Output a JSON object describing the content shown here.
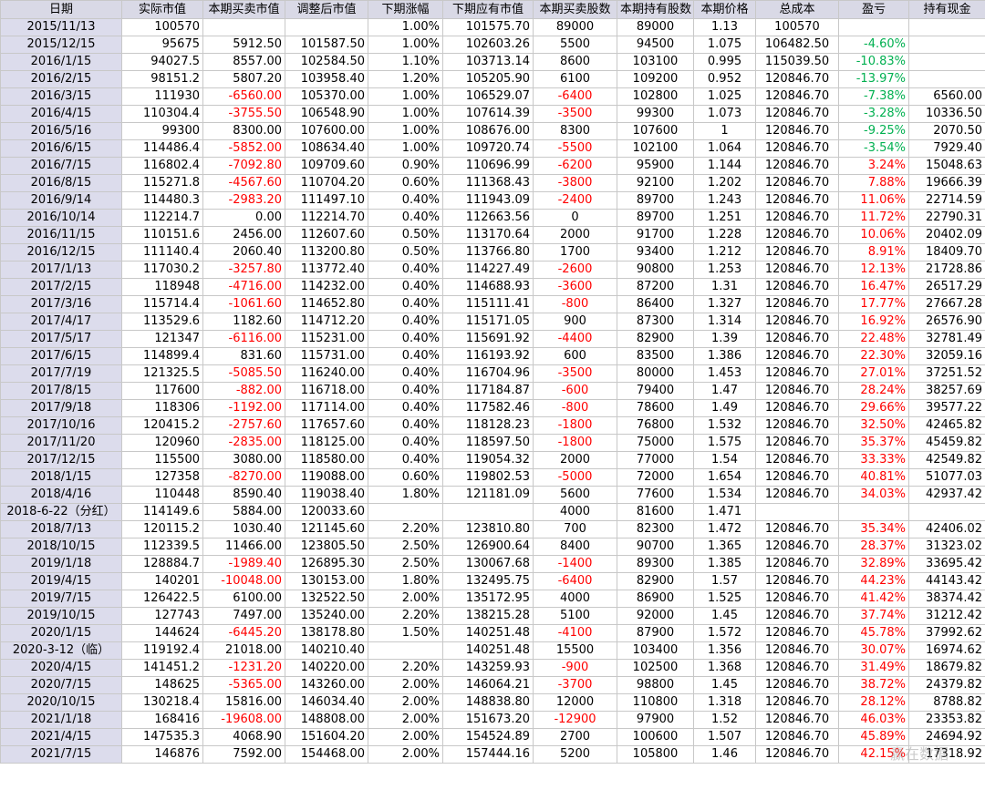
{
  "headers": [
    "日期",
    "实际市值",
    "本期买卖市值",
    "调整后市值",
    "下期涨幅",
    "下期应有市值",
    "本期买卖股数",
    "本期持有股数",
    "本期价格",
    "总成本",
    "盈亏",
    "持有现金"
  ],
  "rows": [
    [
      "2015/11/13",
      "100570",
      "",
      "",
      "1.00%",
      "101575.70",
      "89000",
      "89000",
      "1.13",
      "100570",
      "",
      ""
    ],
    [
      "2015/12/15",
      "95675",
      "5912.50",
      "101587.50",
      "1.00%",
      "102603.26",
      "5500",
      "94500",
      "1.075",
      "106482.50",
      "-4.60%",
      ""
    ],
    [
      "2016/1/15",
      "94027.5",
      "8557.00",
      "102584.50",
      "1.10%",
      "103713.14",
      "8600",
      "103100",
      "0.995",
      "115039.50",
      "-10.83%",
      ""
    ],
    [
      "2016/2/15",
      "98151.2",
      "5807.20",
      "103958.40",
      "1.20%",
      "105205.90",
      "6100",
      "109200",
      "0.952",
      "120846.70",
      "-13.97%",
      ""
    ],
    [
      "2016/3/15",
      "111930",
      "-6560.00",
      "105370.00",
      "1.00%",
      "106529.07",
      "-6400",
      "102800",
      "1.025",
      "120846.70",
      "-7.38%",
      "6560.00"
    ],
    [
      "2016/4/15",
      "110304.4",
      "-3755.50",
      "106548.90",
      "1.00%",
      "107614.39",
      "-3500",
      "99300",
      "1.073",
      "120846.70",
      "-3.28%",
      "10336.50"
    ],
    [
      "2016/5/16",
      "99300",
      "8300.00",
      "107600.00",
      "1.00%",
      "108676.00",
      "8300",
      "107600",
      "1",
      "120846.70",
      "-9.25%",
      "2070.50"
    ],
    [
      "2016/6/15",
      "114486.4",
      "-5852.00",
      "108634.40",
      "1.00%",
      "109720.74",
      "-5500",
      "102100",
      "1.064",
      "120846.70",
      "-3.54%",
      "7929.40"
    ],
    [
      "2016/7/15",
      "116802.4",
      "-7092.80",
      "109709.60",
      "0.90%",
      "110696.99",
      "-6200",
      "95900",
      "1.144",
      "120846.70",
      "3.24%",
      "15048.63"
    ],
    [
      "2016/8/15",
      "115271.8",
      "-4567.60",
      "110704.20",
      "0.60%",
      "111368.43",
      "-3800",
      "92100",
      "1.202",
      "120846.70",
      "7.88%",
      "19666.39"
    ],
    [
      "2016/9/14",
      "114480.3",
      "-2983.20",
      "111497.10",
      "0.40%",
      "111943.09",
      "-2400",
      "89700",
      "1.243",
      "120846.70",
      "11.06%",
      "22714.59"
    ],
    [
      "2016/10/14",
      "112214.7",
      "0.00",
      "112214.70",
      "0.40%",
      "112663.56",
      "0",
      "89700",
      "1.251",
      "120846.70",
      "11.72%",
      "22790.31"
    ],
    [
      "2016/11/15",
      "110151.6",
      "2456.00",
      "112607.60",
      "0.50%",
      "113170.64",
      "2000",
      "91700",
      "1.228",
      "120846.70",
      "10.06%",
      "20402.09"
    ],
    [
      "2016/12/15",
      "111140.4",
      "2060.40",
      "113200.80",
      "0.50%",
      "113766.80",
      "1700",
      "93400",
      "1.212",
      "120846.70",
      "8.91%",
      "18409.70"
    ],
    [
      "2017/1/13",
      "117030.2",
      "-3257.80",
      "113772.40",
      "0.40%",
      "114227.49",
      "-2600",
      "90800",
      "1.253",
      "120846.70",
      "12.13%",
      "21728.86"
    ],
    [
      "2017/2/15",
      "118948",
      "-4716.00",
      "114232.00",
      "0.40%",
      "114688.93",
      "-3600",
      "87200",
      "1.31",
      "120846.70",
      "16.47%",
      "26517.29"
    ],
    [
      "2017/3/16",
      "115714.4",
      "-1061.60",
      "114652.80",
      "0.40%",
      "115111.41",
      "-800",
      "86400",
      "1.327",
      "120846.70",
      "17.77%",
      "27667.28"
    ],
    [
      "2017/4/17",
      "113529.6",
      "1182.60",
      "114712.20",
      "0.40%",
      "115171.05",
      "900",
      "87300",
      "1.314",
      "120846.70",
      "16.92%",
      "26576.90"
    ],
    [
      "2017/5/17",
      "121347",
      "-6116.00",
      "115231.00",
      "0.40%",
      "115691.92",
      "-4400",
      "82900",
      "1.39",
      "120846.70",
      "22.48%",
      "32781.49"
    ],
    [
      "2017/6/15",
      "114899.4",
      "831.60",
      "115731.00",
      "0.40%",
      "116193.92",
      "600",
      "83500",
      "1.386",
      "120846.70",
      "22.30%",
      "32059.16"
    ],
    [
      "2017/7/19",
      "121325.5",
      "-5085.50",
      "116240.00",
      "0.40%",
      "116704.96",
      "-3500",
      "80000",
      "1.453",
      "120846.70",
      "27.01%",
      "37251.52"
    ],
    [
      "2017/8/15",
      "117600",
      "-882.00",
      "116718.00",
      "0.40%",
      "117184.87",
      "-600",
      "79400",
      "1.47",
      "120846.70",
      "28.24%",
      "38257.69"
    ],
    [
      "2017/9/18",
      "118306",
      "-1192.00",
      "117114.00",
      "0.40%",
      "117582.46",
      "-800",
      "78600",
      "1.49",
      "120846.70",
      "29.66%",
      "39577.22"
    ],
    [
      "2017/10/16",
      "120415.2",
      "-2757.60",
      "117657.60",
      "0.40%",
      "118128.23",
      "-1800",
      "76800",
      "1.532",
      "120846.70",
      "32.50%",
      "42465.82"
    ],
    [
      "2017/11/20",
      "120960",
      "-2835.00",
      "118125.00",
      "0.40%",
      "118597.50",
      "-1800",
      "75000",
      "1.575",
      "120846.70",
      "35.37%",
      "45459.82"
    ],
    [
      "2017/12/15",
      "115500",
      "3080.00",
      "118580.00",
      "0.40%",
      "119054.32",
      "2000",
      "77000",
      "1.54",
      "120846.70",
      "33.33%",
      "42549.82"
    ],
    [
      "2018/1/15",
      "127358",
      "-8270.00",
      "119088.00",
      "0.60%",
      "119802.53",
      "-5000",
      "72000",
      "1.654",
      "120846.70",
      "40.81%",
      "51077.03"
    ],
    [
      "2018/4/16",
      "110448",
      "8590.40",
      "119038.40",
      "1.80%",
      "121181.09",
      "5600",
      "77600",
      "1.534",
      "120846.70",
      "34.03%",
      "42937.42"
    ],
    [
      "2018-6-22（分红）",
      "114149.6",
      "5884.00",
      "120033.60",
      "",
      "",
      "4000",
      "81600",
      "1.471",
      "",
      "",
      ""
    ],
    [
      "2018/7/13",
      "120115.2",
      "1030.40",
      "121145.60",
      "2.20%",
      "123810.80",
      "700",
      "82300",
      "1.472",
      "120846.70",
      "35.34%",
      "42406.02"
    ],
    [
      "2018/10/15",
      "112339.5",
      "11466.00",
      "123805.50",
      "2.50%",
      "126900.64",
      "8400",
      "90700",
      "1.365",
      "120846.70",
      "28.37%",
      "31323.02"
    ],
    [
      "2019/1/18",
      "128884.7",
      "-1989.40",
      "126895.30",
      "2.50%",
      "130067.68",
      "-1400",
      "89300",
      "1.385",
      "120846.70",
      "32.89%",
      "33695.42"
    ],
    [
      "2019/4/15",
      "140201",
      "-10048.00",
      "130153.00",
      "1.80%",
      "132495.75",
      "-6400",
      "82900",
      "1.57",
      "120846.70",
      "44.23%",
      "44143.42"
    ],
    [
      "2019/7/15",
      "126422.5",
      "6100.00",
      "132522.50",
      "2.00%",
      "135172.95",
      "4000",
      "86900",
      "1.525",
      "120846.70",
      "41.42%",
      "38374.42"
    ],
    [
      "2019/10/15",
      "127743",
      "7497.00",
      "135240.00",
      "2.20%",
      "138215.28",
      "5100",
      "92000",
      "1.45",
      "120846.70",
      "37.74%",
      "31212.42"
    ],
    [
      "2020/1/15",
      "144624",
      "-6445.20",
      "138178.80",
      "1.50%",
      "140251.48",
      "-4100",
      "87900",
      "1.572",
      "120846.70",
      "45.78%",
      "37992.62"
    ],
    [
      "2020-3-12（临）",
      "119192.4",
      "21018.00",
      "140210.40",
      "",
      "140251.48",
      "15500",
      "103400",
      "1.356",
      "120846.70",
      "30.07%",
      "16974.62"
    ],
    [
      "2020/4/15",
      "141451.2",
      "-1231.20",
      "140220.00",
      "2.20%",
      "143259.93",
      "-900",
      "102500",
      "1.368",
      "120846.70",
      "31.49%",
      "18679.82"
    ],
    [
      "2020/7/15",
      "148625",
      "-5365.00",
      "143260.00",
      "2.00%",
      "146064.21",
      "-3700",
      "98800",
      "1.45",
      "120846.70",
      "38.72%",
      "24379.82"
    ],
    [
      "2020/10/15",
      "130218.4",
      "15816.00",
      "146034.40",
      "2.00%",
      "148838.80",
      "12000",
      "110800",
      "1.318",
      "120846.70",
      "28.12%",
      "8788.82"
    ],
    [
      "2021/1/18",
      "168416",
      "-19608.00",
      "148808.00",
      "2.00%",
      "151673.20",
      "-12900",
      "97900",
      "1.52",
      "120846.70",
      "46.03%",
      "23353.82"
    ],
    [
      "2021/4/15",
      "147535.3",
      "4068.90",
      "151604.20",
      "2.00%",
      "154524.89",
      "2700",
      "100600",
      "1.507",
      "120846.70",
      "45.89%",
      "24694.92"
    ],
    [
      "2021/7/15",
      "146876",
      "7592.00",
      "154468.00",
      "2.00%",
      "157444.16",
      "5200",
      "105800",
      "1.46",
      "120846.70",
      "42.15%",
      "17318.92"
    ]
  ],
  "watermark": "赢在数据"
}
